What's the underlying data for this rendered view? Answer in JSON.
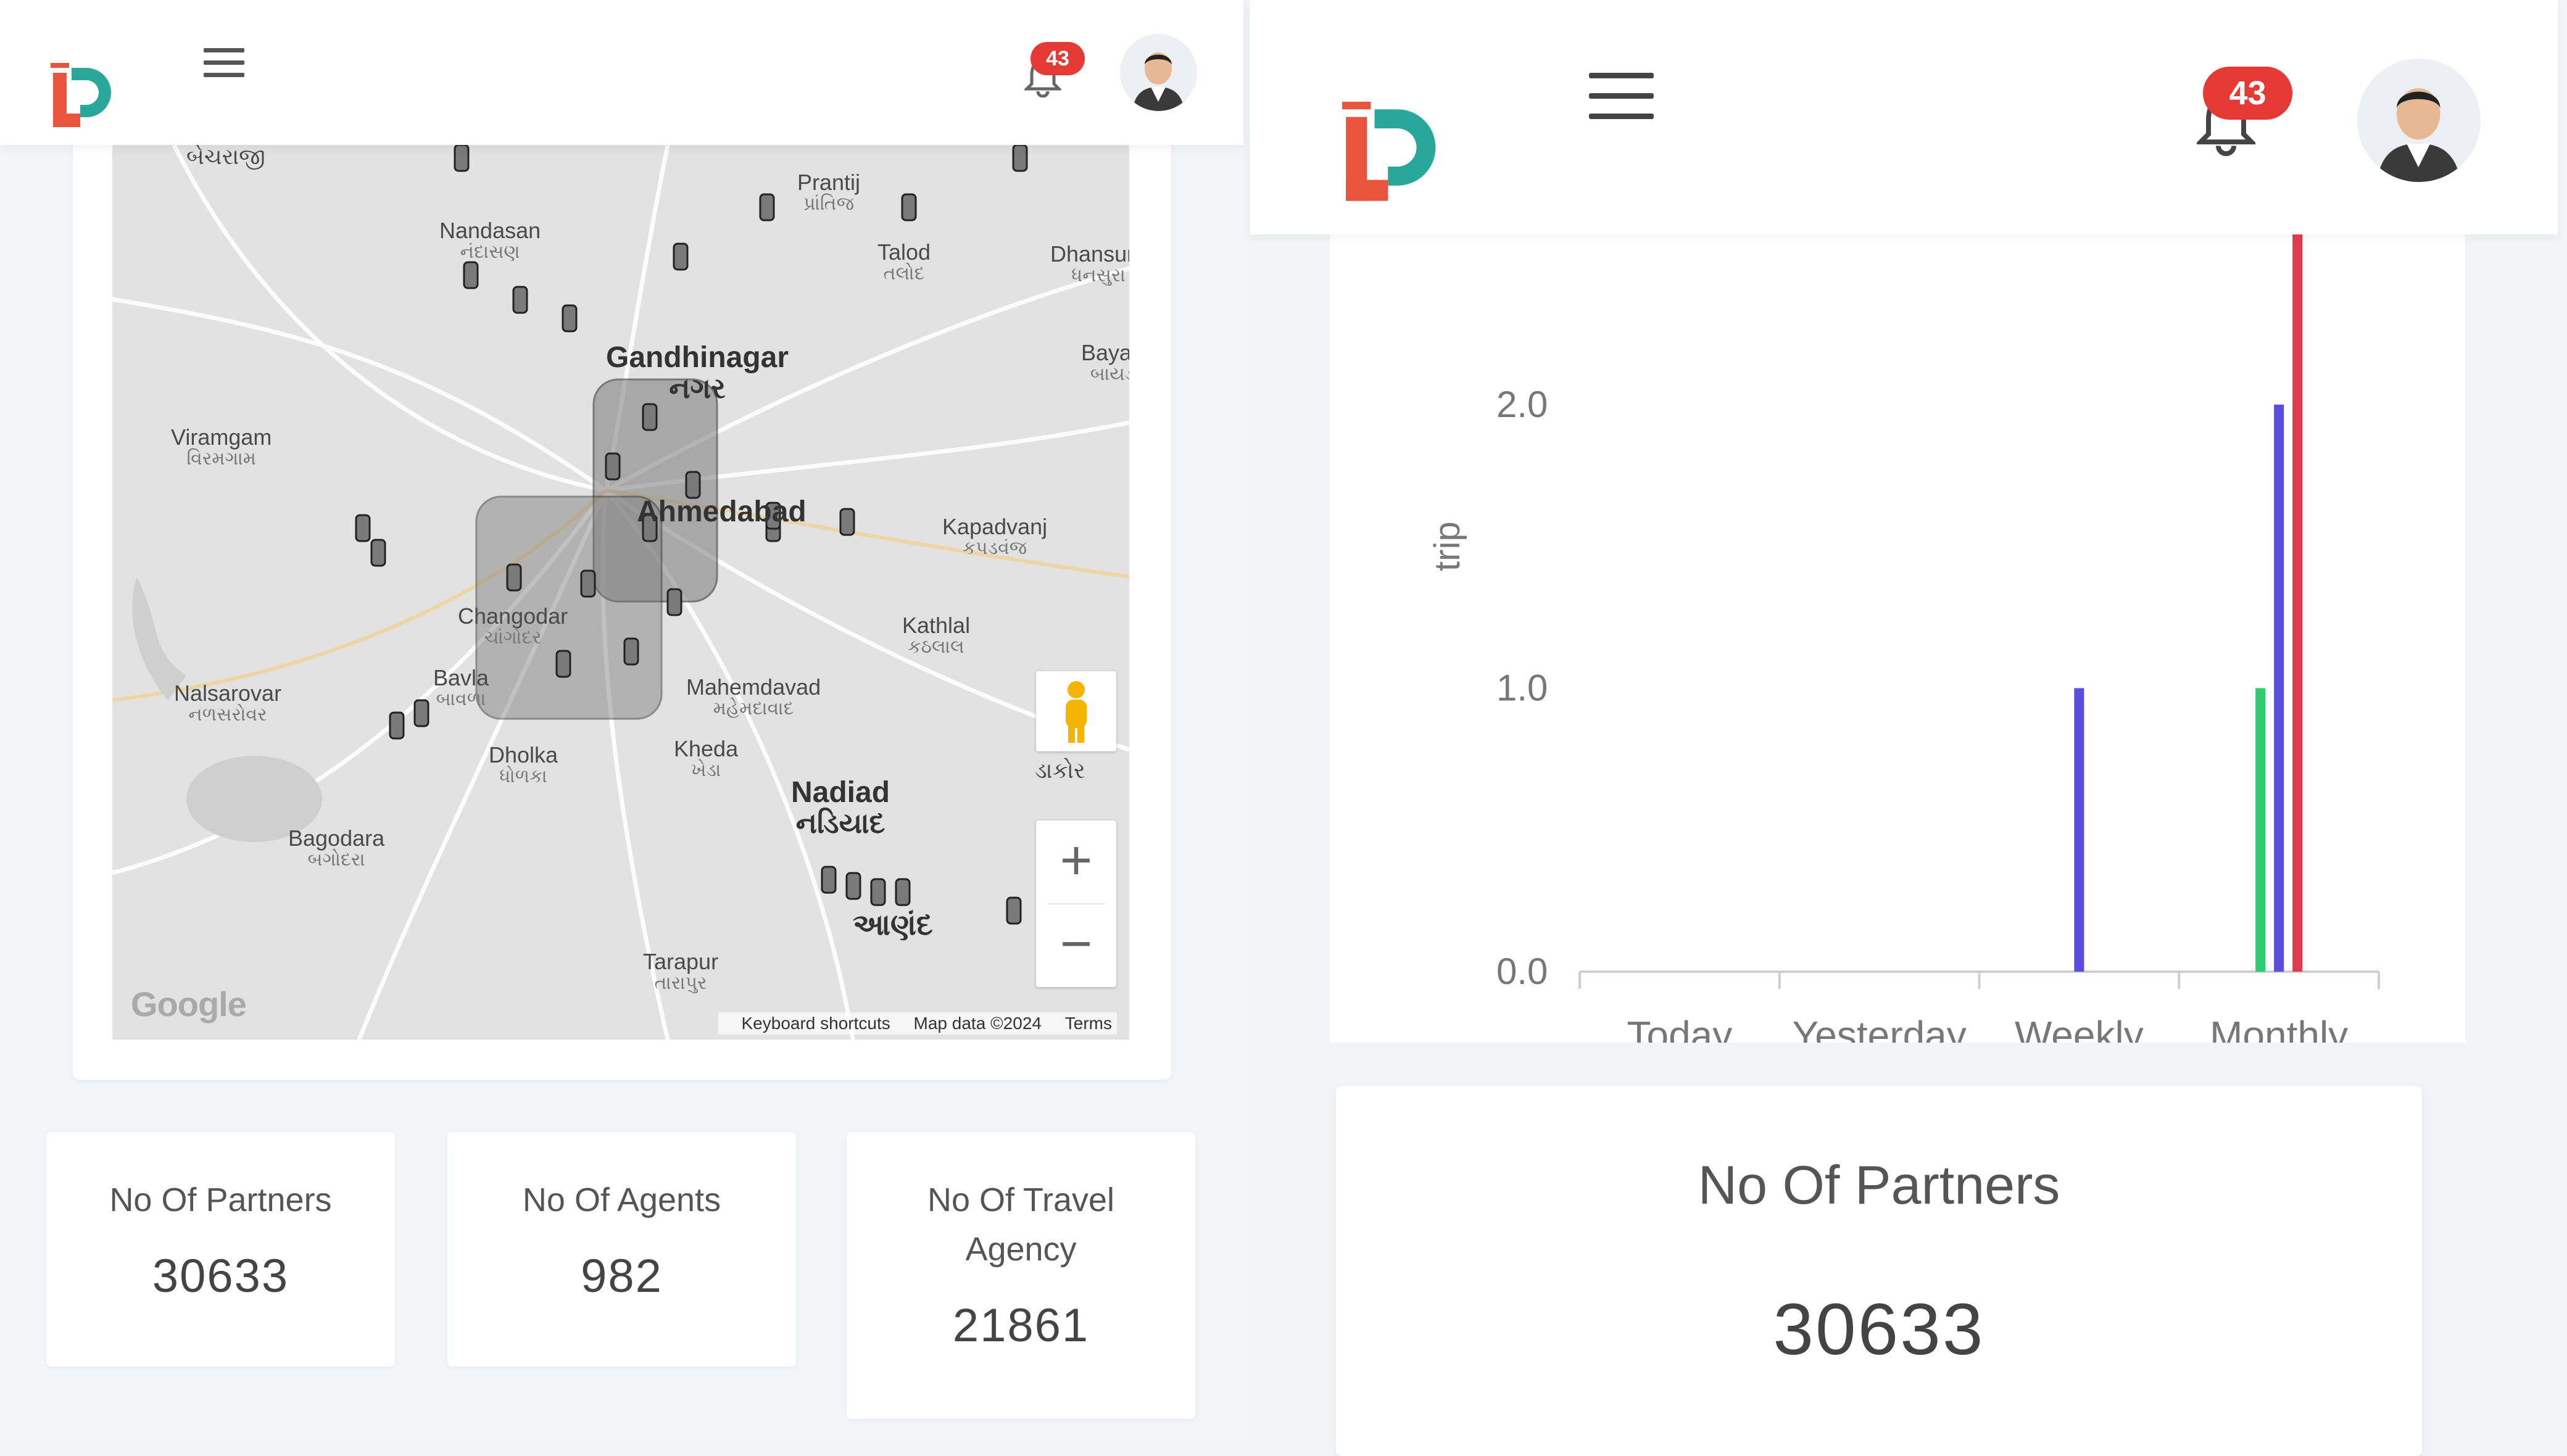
{
  "left_panel": {
    "notifications_count": "43",
    "map": {
      "places": [
        {
          "name": "બેચરાજી",
          "local": ""
        },
        {
          "name": "Nandasan",
          "local": "નંદાસણ"
        },
        {
          "name": "Prantij",
          "local": "પ્રાંતિજ"
        },
        {
          "name": "Talod",
          "local": "તલોદ"
        },
        {
          "name": "Dhansura",
          "local": "ધનસુરા"
        },
        {
          "name": "Bayad",
          "local": "બાયડ"
        },
        {
          "name": "Viramgam",
          "local": "વિરમગામ"
        },
        {
          "name": "Kapadvanj",
          "local": "કપડવંજ"
        },
        {
          "name": "Changodar",
          "local": "ચાંગોદર"
        },
        {
          "name": "Kathlal",
          "local": "કઠલાલ"
        },
        {
          "name": "Nalsarovar",
          "local": "નળસરોવર"
        },
        {
          "name": "Bavla",
          "local": "બાવળા"
        },
        {
          "name": "Mahemdavad",
          "local": "મહેમદાવાદ"
        },
        {
          "name": "Dholka",
          "local": "ધોળકા"
        },
        {
          "name": "Kheda",
          "local": "ખેડા"
        },
        {
          "name": "Nadiad",
          "local": "નડિયાદ"
        },
        {
          "name": "Bagodara",
          "local": "બગોદરા"
        },
        {
          "name": "Tarapur",
          "local": "તારાપુર"
        },
        {
          "name": "ડાકોર",
          "local": ""
        },
        {
          "name": "Gandhinagar",
          "local": "નગર"
        },
        {
          "name": "Ahmedabad",
          "local": ""
        },
        {
          "name": "આણંદ",
          "local": ""
        }
      ],
      "google": "Google",
      "attribution": [
        "Keyboard shortcuts",
        "Map data ©2024",
        "Terms"
      ],
      "zoom_in": "+",
      "zoom_out": "−"
    },
    "stats": [
      {
        "title": "No Of Partners",
        "value": "30633"
      },
      {
        "title": "No Of Agents",
        "value": "982"
      },
      {
        "title": "No Of Travel Agency",
        "value": "21861"
      }
    ]
  },
  "right_panel": {
    "notifications_count": "43",
    "stat": {
      "title": "No Of Partners",
      "value": "30633"
    }
  },
  "chart_data": {
    "type": "bar",
    "ylabel": "trip",
    "yticks": [
      "0.0",
      "1.0",
      "2.0"
    ],
    "ylim": [
      0,
      2.6
    ],
    "categories": [
      "Today",
      "Yesterday",
      "Weekly",
      "Monthly"
    ],
    "series": [
      {
        "color": "#2ecc71",
        "values": [
          0,
          0,
          0,
          1
        ]
      },
      {
        "color": "#5b4de0",
        "values": [
          0,
          0,
          1,
          2
        ]
      },
      {
        "color": "#e03c4f",
        "values": [
          0,
          0,
          0,
          2.6
        ]
      }
    ]
  }
}
